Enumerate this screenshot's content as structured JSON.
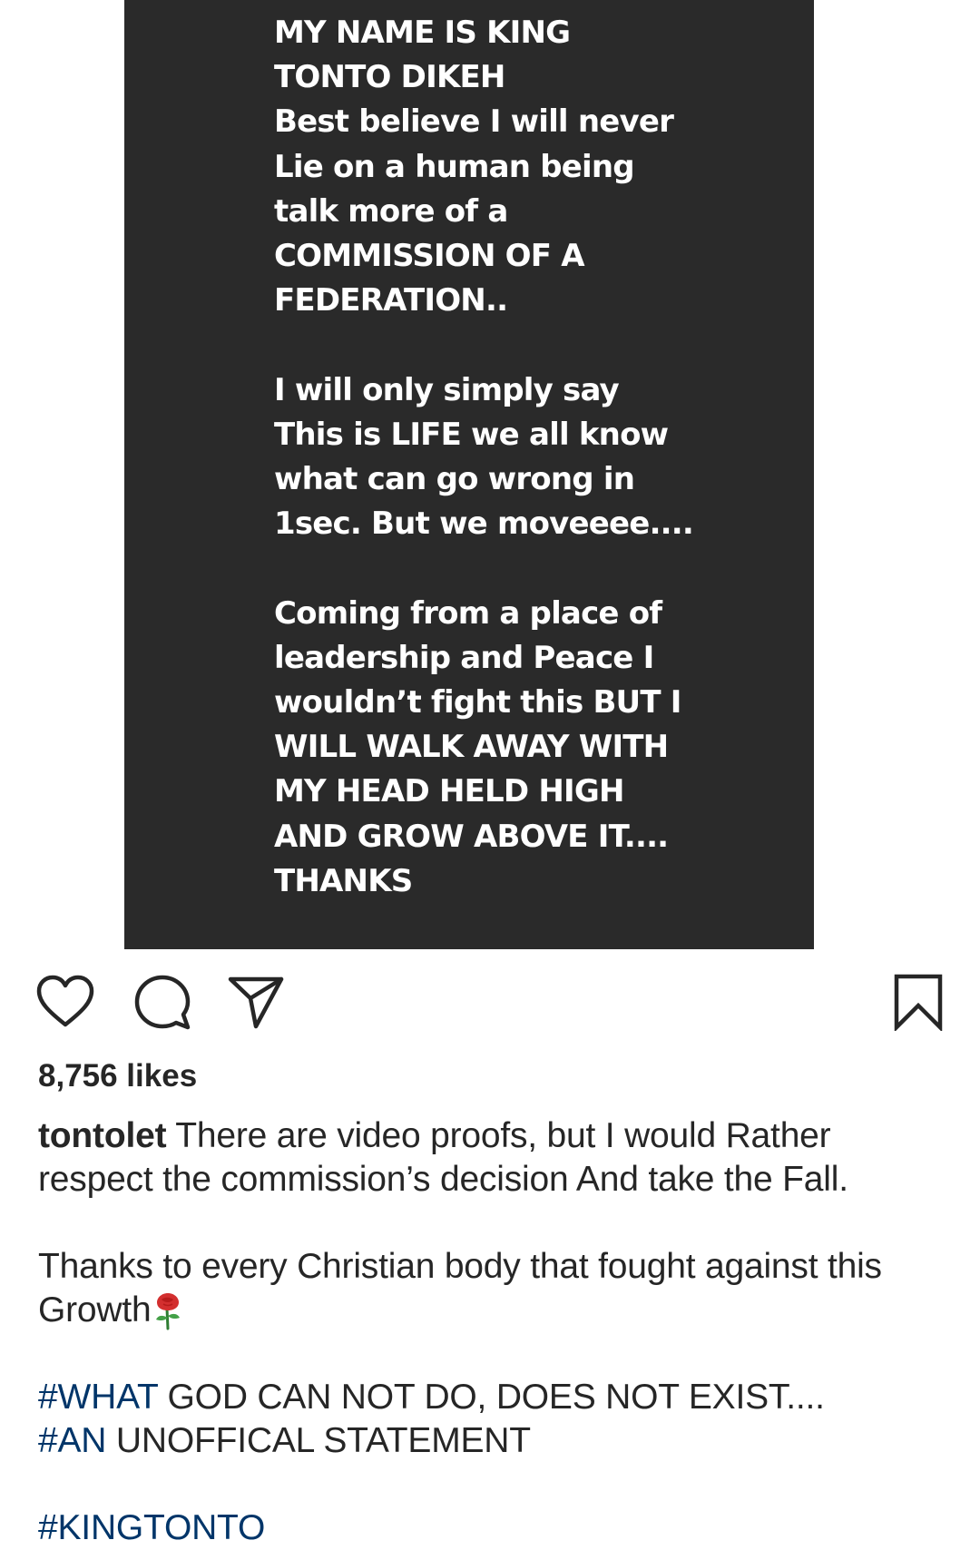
{
  "post": {
    "image_text": {
      "stanza1": [
        "MY NAME IS KING",
        "TONTO DIKEH",
        "Best believe I will never",
        "Lie on a human being",
        "talk more of a",
        "COMMISSION OF A",
        "FEDERATION.."
      ],
      "stanza2": [
        "I will only simply say",
        "This is LIFE we all know",
        "what can go wrong in",
        "1sec. But we moveeee...."
      ],
      "stanza3": [
        "Coming from a place of",
        "leadership and Peace I",
        "wouldn’t fight this BUT I",
        "WILL WALK AWAY WITH",
        "MY HEAD HELD HIGH",
        "AND GROW ABOVE IT....",
        "THANKS"
      ]
    },
    "actions": {
      "like_icon": "heart-icon",
      "comment_icon": "comment-bubble-icon",
      "share_icon": "paper-plane-icon",
      "save_icon": "bookmark-icon"
    },
    "likes": "8,756 likes",
    "caption": {
      "username": "tontolet",
      "text1": " There are video proofs, but I would Rather respect the commission’s decision And take the Fall.",
      "text2": "Thanks to every Christian body that fought against this Growth",
      "emoji": "rose-emoji",
      "line3_tag": "#WHAT",
      "line3_rest": " GOD CAN NOT DO, DOES NOT EXIST....",
      "line4_tag": "#AN",
      "line4_rest": " UNOFFICAL STATEMENT",
      "line5_tag": "#KINGTONTO"
    },
    "colors": {
      "image_background": "#2a2a2a",
      "hashtag": "#003569",
      "text": "#262626"
    }
  }
}
